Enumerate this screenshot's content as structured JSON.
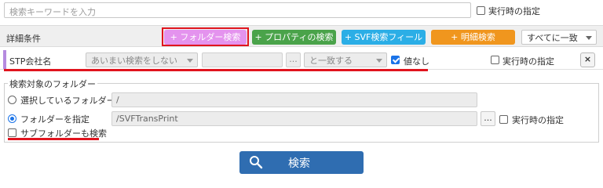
{
  "search": {
    "placeholder": "検索キーワードを入力",
    "runtime_label": "実行時の指定"
  },
  "detail_bar": {
    "label": "詳細条件",
    "folder_search_btn": "+ フォルダー検索",
    "property_search_btn": "+ プロパティの検索",
    "svf_field_btn": "+ SVF検索フィールド",
    "detail_search_btn": "+ 明細検索",
    "match_select": "すべてに一致"
  },
  "condition_row": {
    "name": "STP会社名",
    "fuzzy_select": "あいまい検索をしない",
    "value": "",
    "ellipsis": "...",
    "match_select": "と一致する",
    "no_value_label": "値なし",
    "runtime_label": "実行時の指定",
    "close": "×"
  },
  "folder_group": {
    "legend": "検索対象のフォルダー",
    "selected_folder_label": "選択しているフォルダー",
    "selected_folder_path": "/",
    "specify_folder_label": "フォルダーを指定",
    "specify_folder_path": "/SVFTransPrint",
    "ellipsis": "...",
    "runtime_label": "実行時の指定",
    "subfolder_label": "サブフォルダーも検索"
  },
  "search_button": {
    "label": "検索"
  },
  "colors": {
    "folder_btn": "#e493ee",
    "property_btn": "#4aa34a",
    "svf_btn": "#2baee6",
    "detail_btn": "#f0961e",
    "search_btn": "#2f6db1",
    "highlight": "#e0141e",
    "accent": "#b58adf"
  }
}
